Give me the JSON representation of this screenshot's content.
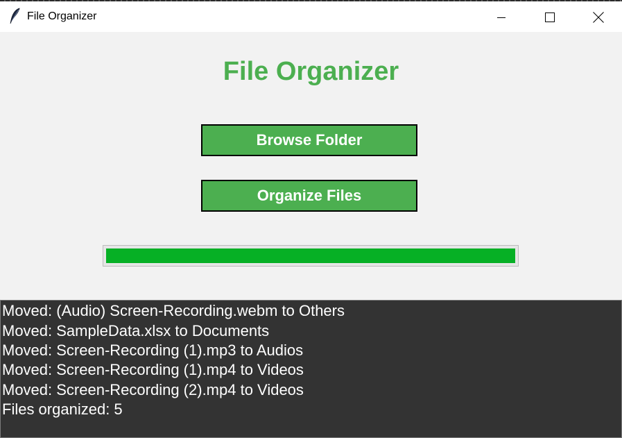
{
  "window": {
    "title": "File Organizer",
    "icon": "feather-icon",
    "controls": {
      "minimize": "minimize-icon",
      "maximize": "maximize-icon",
      "close": "close-icon"
    }
  },
  "app": {
    "heading": "File Organizer",
    "browse_button_label": "Browse Folder",
    "organize_button_label": "Organize Files",
    "progress": 1.0,
    "colors": {
      "accent": "#4caf50",
      "progress": "#06b025",
      "log_background": "#333333"
    }
  },
  "log": {
    "lines": [
      "Moved: (Audio) Screen-Recording.webm to Others",
      "Moved: SampleData.xlsx to Documents",
      "Moved: Screen-Recording (1).mp3 to Audios",
      "Moved: Screen-Recording (1).mp4 to Videos",
      "Moved: Screen-Recording (2).mp4 to Videos",
      "Files organized: 5"
    ]
  }
}
